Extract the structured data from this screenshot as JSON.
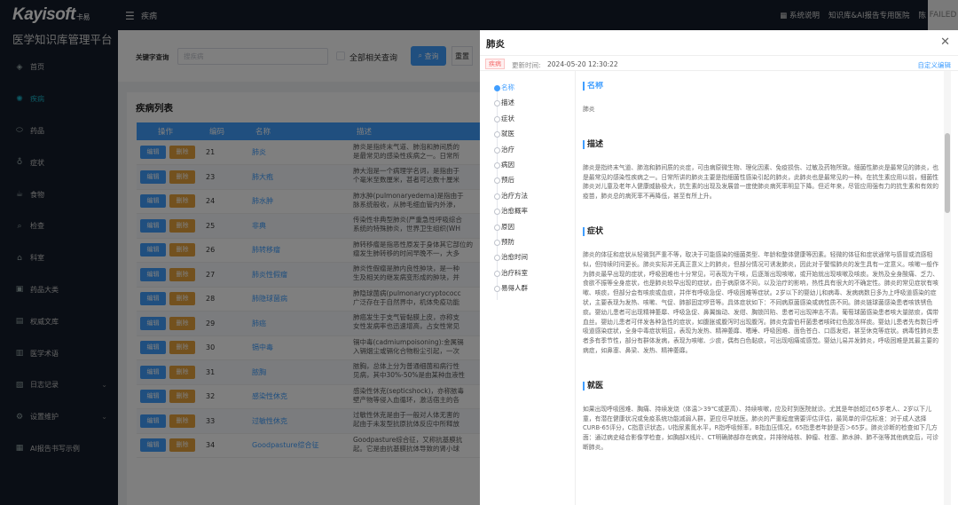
{
  "header": {
    "logo": "Kayisoft",
    "logo_sub": "卡易",
    "menu_icon": "menu-icon",
    "breadcrumb": "疾病",
    "links": [
      "系统说明",
      "知识库&AI报告专用医院"
    ],
    "user_prefix": "陈",
    "avatar_alt": "FAILED"
  },
  "sidebar": {
    "title": "医学知识库管理平台",
    "items": [
      {
        "label": "首页",
        "icon": "layers-icon"
      },
      {
        "label": "疾病",
        "icon": "virus-icon"
      },
      {
        "label": "药品",
        "icon": "pill-icon"
      },
      {
        "label": "症状",
        "icon": "stethoscope-icon"
      },
      {
        "label": "食物",
        "icon": "food-icon"
      },
      {
        "label": "检查",
        "icon": "search-icon"
      },
      {
        "label": "科室",
        "icon": "department-icon"
      },
      {
        "label": "药品大类",
        "icon": "box-icon"
      },
      {
        "label": "权威文库",
        "icon": "library-icon"
      },
      {
        "label": "医学术语",
        "icon": "term-icon"
      },
      {
        "label": "日志记录",
        "icon": "log-icon",
        "expandable": true
      },
      {
        "label": "设置维护",
        "icon": "gear-icon",
        "expandable": true
      },
      {
        "label": "AI报告书写示例",
        "icon": "report-icon"
      }
    ],
    "active": "疾病"
  },
  "filter": {
    "label": "关键字查询",
    "placeholder": "搜疾病",
    "checkbox_label": "全部相关查询",
    "search_btn": "查询",
    "reset_btn": "重置"
  },
  "list": {
    "title": "疾病列表",
    "columns": [
      "操作",
      "编码",
      "名称",
      "描述"
    ],
    "edit_label": "编辑",
    "delete_label": "删除",
    "rows": [
      {
        "code": "21",
        "name": "肺炎",
        "desc": "肺炎是指终末气道、肺泡和肺间质的\n是最常见的感染性疾病之一。日常所"
      },
      {
        "code": "23",
        "name": "肺大疱",
        "desc": "肺大泡是一个病理学名词，是指由于\n个毫米至数厘米，甚者可达数十厘米"
      },
      {
        "code": "24",
        "name": "肺水肿",
        "desc": "肺水肿(pulmonaryedema)是指由于\n脉系统般收，从肺毛细血管内外渗，"
      },
      {
        "code": "25",
        "name": "非典",
        "desc": "传染性非典型肺炎(严重急性呼吸综合\n系统的特殊肺炎，世界卫生组织(WH"
      },
      {
        "code": "26",
        "name": "肺转移瘤",
        "desc": "肺转移瘤是指恶性原发于身体其它部位的\n瘤发生肺转移的时间早晚不一，大多"
      },
      {
        "code": "27",
        "name": "肺炎性假瘤",
        "desc": "肺炎性假瘤是肺内良性肿块，是一种\n生及相关的继发病变形成的肿块，并"
      },
      {
        "code": "28",
        "name": "肺隐球菌病",
        "desc": "肺隐球菌病(pulmonarycryptococc\n广泛存在于自然界中，机体免疫功能"
      },
      {
        "code": "29",
        "name": "肺癌",
        "desc": "肺癌发生于支气管黏膜上皮，亦称支\n女性发病率也迅速增高，占女性常见"
      },
      {
        "code": "30",
        "name": "镉中毒",
        "desc": "镉中毒(cadmiumpoisoning):金属镉\n入镉烟尘或镉化合物粉尘引起，一次"
      },
      {
        "code": "31",
        "name": "脓胸",
        "desc": "脓胸，总体上分为普通细菌和病行性\n见病，其中30%-50%是由某种血液性"
      },
      {
        "code": "32",
        "name": "感染性休克",
        "desc": "感染性休克(septicshock)，亦称脓毒\n壁产物等侵入血循环，激活宿主的各"
      },
      {
        "code": "33",
        "name": "过敏性休克",
        "desc": "过敏性休克是由于一般对人体无害的\n起由于未发型抗原抗体反应中所释放"
      },
      {
        "code": "34",
        "name": "Goodpasture综合征",
        "desc": "Goodpasture综合征，又称抗基膜抗\n起。它是由抗基膜抗体导致的肾小球"
      }
    ]
  },
  "drawer": {
    "title": "肺炎",
    "tag": "疾病",
    "updated_label": "更新时间:",
    "updated_value": "2024-05-20 12:30:22",
    "custom_link": "自定义编辑",
    "toc": [
      "名称",
      "描述",
      "症状",
      "就医",
      "治疗",
      "病因",
      "预后",
      "治疗方法",
      "治愈概率",
      "原因",
      "预防",
      "治愈时间",
      "治疗科室",
      "易得人群"
    ],
    "toc_active": "名称",
    "sections": [
      {
        "heading": "名称",
        "text": "肺炎"
      },
      {
        "heading": "描述",
        "text": "肺炎是指终末气道、肺泡和肺间质的炎症，可由病原微生物、理化因素、免疫损伤、过敏及药物所致。细菌性肺炎是最常见的肺炎，也是最常见的感染性疾病之一。日常所讲的肺炎主要是指细菌性感染引起的肺炎，此肺炎也是最常见的一种。在抗生素应用以前，细菌性肺炎对儿童及老年人健康威胁极大，抗生素的出现及发展曾一度使肺炎病死率明显下降。但近年来，尽管应用强有力的抗生素和有效的疫苗，肺炎总的病死率不再降低，甚至有所上升。"
      },
      {
        "heading": "症状",
        "text": "肺炎的体征和症状从轻微到严重不等，取决于可能感染的细菌类型、年龄和整体健康等因素。轻微的体征和症状通常与感冒或流感相似，但持续时间更长。肺炎实际并无真正意义上的肺炎，但部分情况可诱发肺炎，因此对于警惕肺炎的发生具有一定意义。咳嗽一般作为肺炎最早出现的症状，呼吸困难也十分常见，可表现为干咳，后逐渐出现咳嗽，或开始就出现咳嗽及咳痰。发热及全身酸痛、乏力、食欲不振等全身症状，也是肺炎较早出现的症状，由于病原体不同，以及治疗的影响，热性具有很大的不确定性。肺炎的常见症状有咳嗽、咳痰，但部分会有咳痰或血痰，并伴有呼吸急促、呼吸困难等症状。2岁以下的婴幼儿和病毒、发病病数日多为上呼吸道感染的症状，主要表现为发热、咳嗽、气促、肺部固定啰音等。具体症状如下：不同病原菌感染或病性质不同。肺炎链球菌感染患者咳铁锈色痰。婴幼儿患者可出现精神萎靡、呼吸急促、鼻翼煽动、发绀、胸锁凹陷、患者可出现神志不清。葡萄球菌感染患者咳大量脓痰，偶带血丝。婴幼儿患者可伴发各种急性的症状，如腹胀或腹泻时出现腹泻。肺炎克雷伯杆菌患者咳砖红色胶冻样痰。婴幼儿患者先有数日呼吸道感染症状，全身中毒症状明显，表现为发热、精神萎靡、嗜睡、呼吸困难、面色苍白、口唇发绀，甚至休克等症状。病毒性肺炎患者多有季节性，部分有群体发病，表现为咳嗽、少痰，偶有白色黏痰，可出现咽痛或感觉。婴幼儿易并发肺炎，呼吸困难是其最主要的病症，如鼻塞、鼻梁、发热、精神萎靡。"
      },
      {
        "heading": "就医",
        "text": "如果出现呼吸困难、胸痛、持续发烧（体温＞39℃或更高）、持续咳嗽，应及时到医院就诊。尤其是年龄超过65岁老人、2岁以下儿童，有潜在健康状况或免疫系统功能减弱人群，更应尽早就医。肺炎的严重程度需要评估评估，最简单的评估标准：对于成人选择CURB-65评分，C指意识状态，U指尿素氮水平，R指呼吸频率，B指血压情况，65指患者年龄是否＞65岁。肺炎诊断的检查如下几方面：通过病史结合影像学检查，如胸部X线片、CT明确肺部存在病变，并排除结核、肿瘤、栓塞、肺水肿、肺不张等其他病变后，可诊断肺炎。"
      }
    ]
  }
}
